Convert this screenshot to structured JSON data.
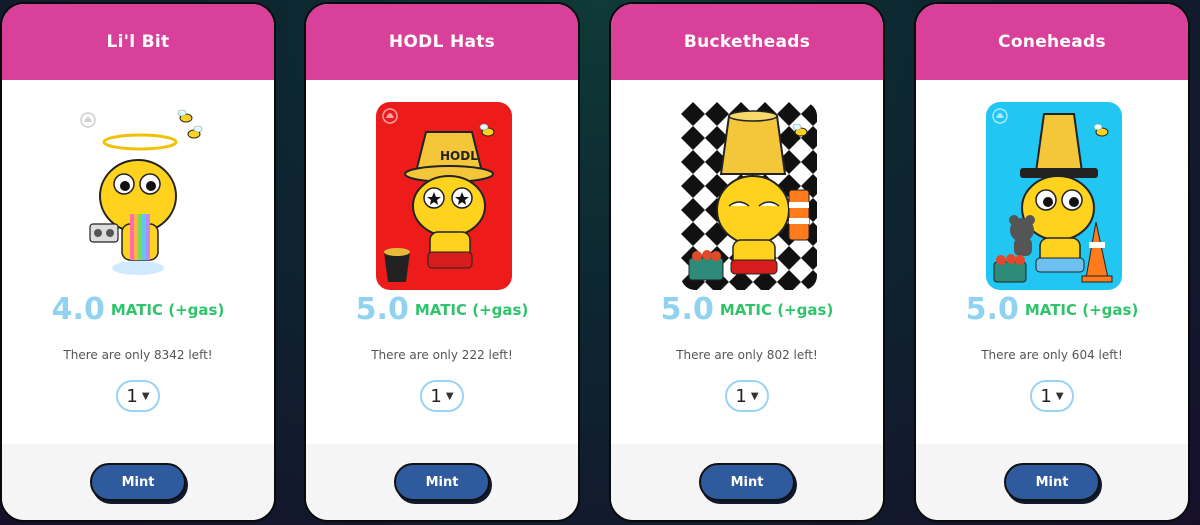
{
  "cards": [
    {
      "title": "Li'l Bit",
      "price": "4.0",
      "unit": "MATIC (+gas)",
      "remaining": "There are only 8342 left!",
      "quantity": "1",
      "mint_label": "Mint",
      "art_bg": "#ffffff"
    },
    {
      "title": "HODL Hats",
      "price": "5.0",
      "unit": "MATIC (+gas)",
      "remaining": "There are only 222 left!",
      "quantity": "1",
      "mint_label": "Mint",
      "art_bg": "#ee1b1b",
      "hat_text": "HODL"
    },
    {
      "title": "Bucketheads",
      "price": "5.0",
      "unit": "MATIC (+gas)",
      "remaining": "There are only 802 left!",
      "quantity": "1",
      "mint_label": "Mint",
      "art_bg": "checker"
    },
    {
      "title": "Coneheads",
      "price": "5.0",
      "unit": "MATIC (+gas)",
      "remaining": "There are only 604 left!",
      "quantity": "1",
      "mint_label": "Mint",
      "art_bg": "#21c6f2"
    }
  ],
  "colors": {
    "header": "#d8409a",
    "price": "#8fd3f0",
    "unit": "#2fc46a",
    "mint_button": "#2f5a9e",
    "character": "#ffd21e"
  }
}
